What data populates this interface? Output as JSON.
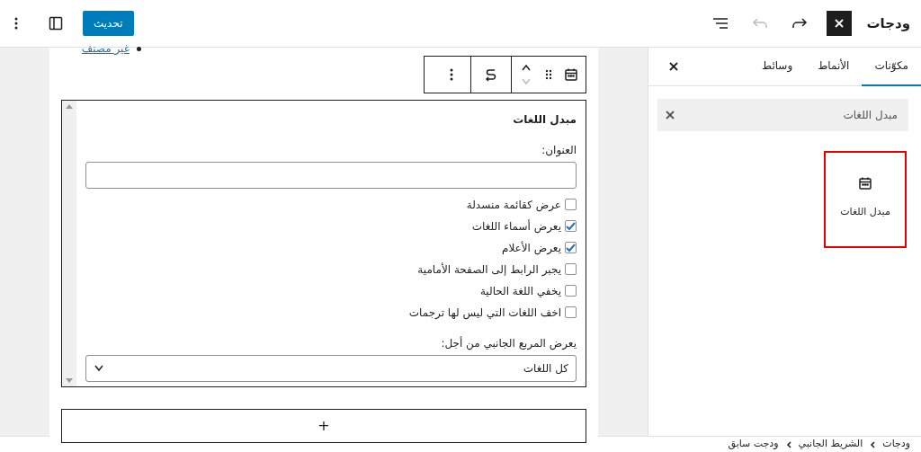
{
  "header": {
    "title": "ودجات",
    "update_button": "تحديث",
    "undo_disabled": true,
    "redo_disabled": false
  },
  "sidebar": {
    "tabs": [
      {
        "label": "مكوّنات",
        "selected": true
      },
      {
        "label": "الأنماط",
        "selected": false
      },
      {
        "label": "وسائط",
        "selected": false
      }
    ],
    "search": {
      "value": "مبدل اللغات"
    },
    "results": [
      {
        "label": "مبدل اللغات",
        "highlighted": true
      }
    ]
  },
  "canvas": {
    "list_items": [
      "غير مصنف"
    ],
    "block_toolbar": {
      "move_up_disabled": false,
      "move_down_disabled": true
    },
    "widget": {
      "title": "مبدل اللغات",
      "title_label": "العنوان:",
      "options": [
        {
          "label": "عرض كقائمة منسدلة",
          "checked": false
        },
        {
          "label": "يعرض أسماء اللغات",
          "checked": true
        },
        {
          "label": "يعرض الأعلام",
          "checked": true
        },
        {
          "label": "يجبر الرابط إلى الصفحة الأمامية",
          "checked": false
        },
        {
          "label": "يخفي اللغة الحالية",
          "checked": false
        },
        {
          "label": "اخف اللغات التي ليس لها ترجمات",
          "checked": false
        }
      ],
      "select_label": "يعرض المربع الجانبي من أجل:",
      "select_value": "كل اللغات"
    },
    "appender": "+"
  },
  "breadcrumb": [
    "ودجات",
    "الشريط الجانبي",
    "ودجت سابق"
  ]
}
